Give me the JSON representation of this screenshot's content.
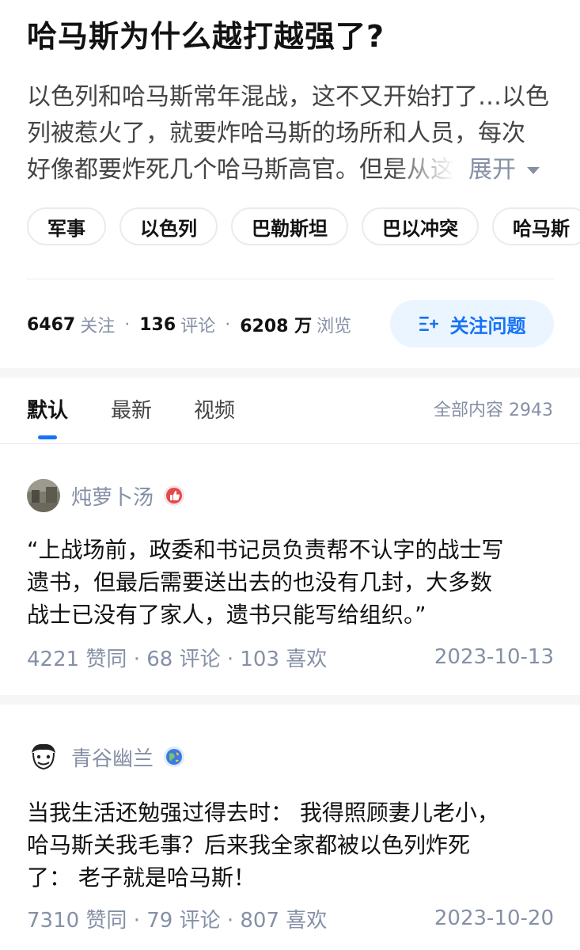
{
  "question": {
    "title": "哈马斯为什么越打越强了?",
    "excerpt_lines": [
      "以色列和哈马斯常年混战，这不又开始打了…以色",
      "列被惹火了，就要炸哈马斯的场所和人员，每次",
      "好像都要炸死几个哈马斯高官。但是从这"
    ],
    "expand_label": "展开",
    "topics": [
      "军事",
      "以色列",
      "巴勒斯坦",
      "巴以冲突",
      "哈马斯"
    ],
    "stats": {
      "followers_num": "6467",
      "followers_label": "关注",
      "comments_num": "136",
      "comments_label": "评论",
      "views_num": "6208 万",
      "views_label": "浏览"
    },
    "follow_button_label": "关注问题"
  },
  "tabs": {
    "items": [
      "默认",
      "最新",
      "视频"
    ],
    "active_index": 0,
    "content_count": "全部内容 2943"
  },
  "answers": [
    {
      "author": "炖萝卜汤",
      "badge_icon": "thumb-badge-icon",
      "lines": [
        "“上战场前，政委和书记员负责帮不认字的战士写",
        "遗书，但最后需要送出去的也没有几封，大多数",
        "战士已没有了家人，遗书只能写给组织。”"
      ],
      "meta": "4221 赞同 · 68 评论 · 103 喜欢",
      "date": "2023-10-13"
    },
    {
      "author": "青谷幽兰",
      "badge_icon": "globe-badge-icon",
      "lines": [
        "当我生活还勉强过得去时： 我得照顾妻儿老小，",
        "哈马斯关我毛事？后来我全家都被以色列炸死",
        "了： 老子就是哈马斯！"
      ],
      "meta": "7310 赞同 · 79 评论 · 807 喜欢",
      "date": "2023-10-20"
    }
  ],
  "colors": {
    "accent": "#1772f6",
    "muted": "#8590a6",
    "follow_bg": "#ebf5ff"
  }
}
